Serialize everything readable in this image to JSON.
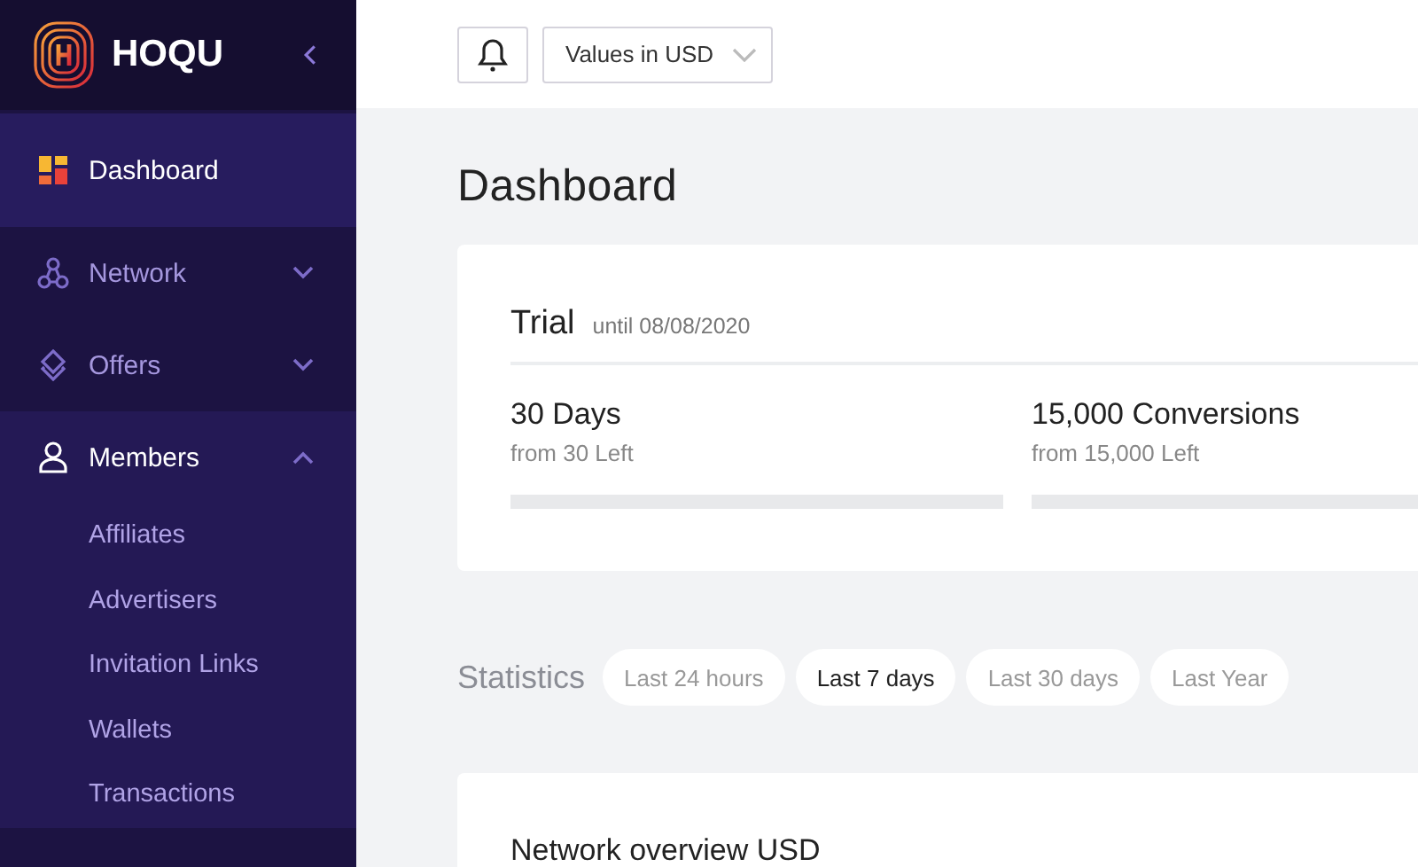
{
  "sidebar": {
    "brand": "HOQU",
    "items": [
      {
        "kind": "link",
        "label": "Dashboard",
        "selected": true,
        "expanded": false
      },
      {
        "kind": "group",
        "label": "Network",
        "selected": false,
        "expanded": false
      },
      {
        "kind": "group",
        "label": "Offers",
        "selected": false,
        "expanded": false
      },
      {
        "kind": "group",
        "label": "Members",
        "selected": false,
        "expanded": true,
        "children": [
          {
            "label": "Affiliates"
          },
          {
            "label": "Advertisers"
          },
          {
            "label": "Invitation Links"
          },
          {
            "label": "Wallets"
          },
          {
            "label": "Transactions"
          }
        ]
      }
    ]
  },
  "topbar": {
    "currency_select": "Values in USD"
  },
  "page_title": "Dashboard",
  "trial": {
    "title": "Trial",
    "until": "until 08/08/2020",
    "meters": [
      {
        "value": "30 Days",
        "caption": "from 30 Left",
        "level": 0
      },
      {
        "value": "15,000 Conversions",
        "caption": "from 15,000 Left",
        "level": 0
      }
    ]
  },
  "statistics": {
    "label": "Statistics",
    "periods": [
      {
        "label": "Last 24 hours",
        "selected": false
      },
      {
        "label": "Last 7 days",
        "selected": true
      },
      {
        "label": "Last 30 days",
        "selected": false
      },
      {
        "label": "Last Year",
        "selected": false
      }
    ]
  },
  "overview": {
    "title": "Network overview",
    "unit": "USD"
  }
}
